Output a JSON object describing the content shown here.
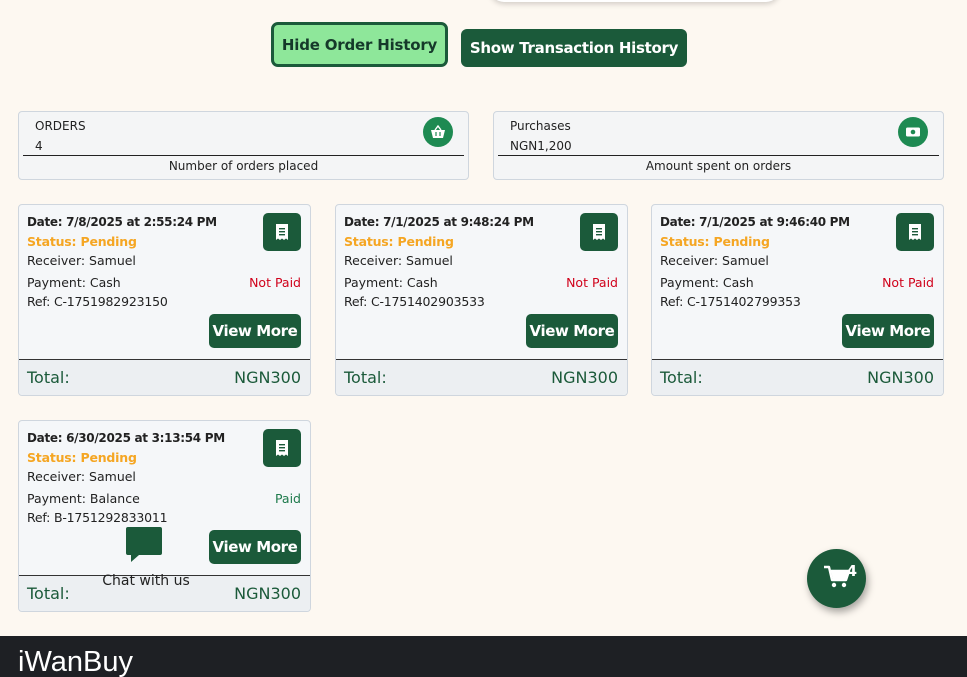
{
  "buttons": {
    "hide_order_history": "Hide Order History",
    "show_transaction_history": "Show Transaction History"
  },
  "summary": {
    "orders": {
      "label": "ORDERS",
      "value": "4",
      "caption": "Number of orders placed",
      "icon": "basket-icon"
    },
    "purchases": {
      "label": "Purchases",
      "value": "NGN1,200",
      "caption": "Amount spent on orders",
      "icon": "money-icon"
    }
  },
  "orders": [
    {
      "date": "Date: 7/8/2025 at 2:55:24 PM",
      "status": "Status: Pending",
      "receiver": "Receiver: Samuel",
      "payment": "Payment: Cash",
      "payment_status": "Not Paid",
      "ref": "Ref: C-1751982923150",
      "view_label": "View More",
      "total_label": "Total:",
      "total_value": "NGN300"
    },
    {
      "date": "Date: 7/1/2025 at 9:48:24 PM",
      "status": "Status: Pending",
      "receiver": "Receiver: Samuel",
      "payment": "Payment: Cash",
      "payment_status": "Not Paid",
      "ref": "Ref: C-1751402903533",
      "view_label": "View More",
      "total_label": "Total:",
      "total_value": "NGN300"
    },
    {
      "date": "Date: 7/1/2025 at 9:46:40 PM",
      "status": "Status: Pending",
      "receiver": "Receiver: Samuel",
      "payment": "Payment: Cash",
      "payment_status": "Not Paid",
      "ref": "Ref: C-1751402799353",
      "view_label": "View More",
      "total_label": "Total:",
      "total_value": "NGN300"
    },
    {
      "date": "Date: 6/30/2025 at 3:13:54 PM",
      "status": "Status: Pending",
      "receiver": "Receiver: Samuel",
      "payment": "Payment: Balance",
      "payment_status": "Paid",
      "ref": "Ref: B-1751292833011",
      "view_label": "View More",
      "total_label": "Total:",
      "total_value": "NGN300"
    }
  ],
  "chat": {
    "label": "Chat with us",
    "icon": "chat-bubble-icon"
  },
  "cart": {
    "count": "4",
    "icon": "cart-icon"
  },
  "footer": {
    "brand": "iWanBuy"
  },
  "colors": {
    "brand_green": "#1b5a3a",
    "light_green": "#8ee79a",
    "pending": "#f5a623",
    "not_paid": "#d0021b",
    "paid": "#1e7a4c",
    "page_bg": "#fdf8f1",
    "footer_bg": "#1e2024"
  }
}
